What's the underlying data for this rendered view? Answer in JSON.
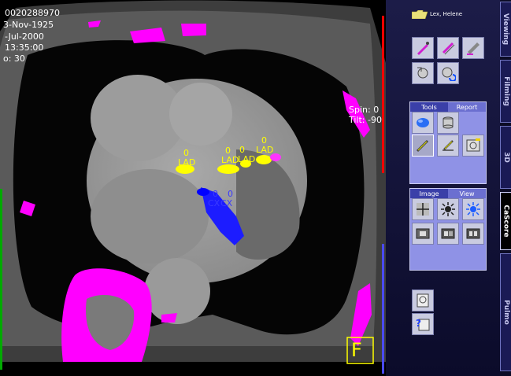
{
  "viewer": {
    "overlay_lines": [
      "0020288970",
      "3-Nov-1925",
      "-Jul-2000",
      "13:35:00",
      "o: 30"
    ],
    "spin_label": "Spin: 0",
    "tilt_label": "Tilt: -90",
    "orientation_marker": "F"
  },
  "annotations": {
    "lad_values": [
      "0",
      "0",
      "0",
      "0"
    ],
    "lad_labels": [
      "LAD",
      "LAD",
      "LAD",
      "LAD"
    ],
    "cx_values": [
      "0",
      "0"
    ],
    "cx_labels": [
      "CX",
      "CX"
    ]
  },
  "patient": {
    "name": "Lex, Helene"
  },
  "tools_tabs": [
    "Tools",
    "Report"
  ],
  "image_tabs": [
    "Image",
    "View"
  ],
  "side_tabs": [
    "Viewing",
    "Filming",
    "3D",
    "CaScore",
    "Pulmo"
  ],
  "active_side_tab": "CaScore",
  "colors": {
    "accent": "#8f92e6",
    "panel": "#1c1c48",
    "calcium_bone": "#ff00ff",
    "lesion_yellow": "#ffff00",
    "lesion_blue": "#0000ff"
  }
}
